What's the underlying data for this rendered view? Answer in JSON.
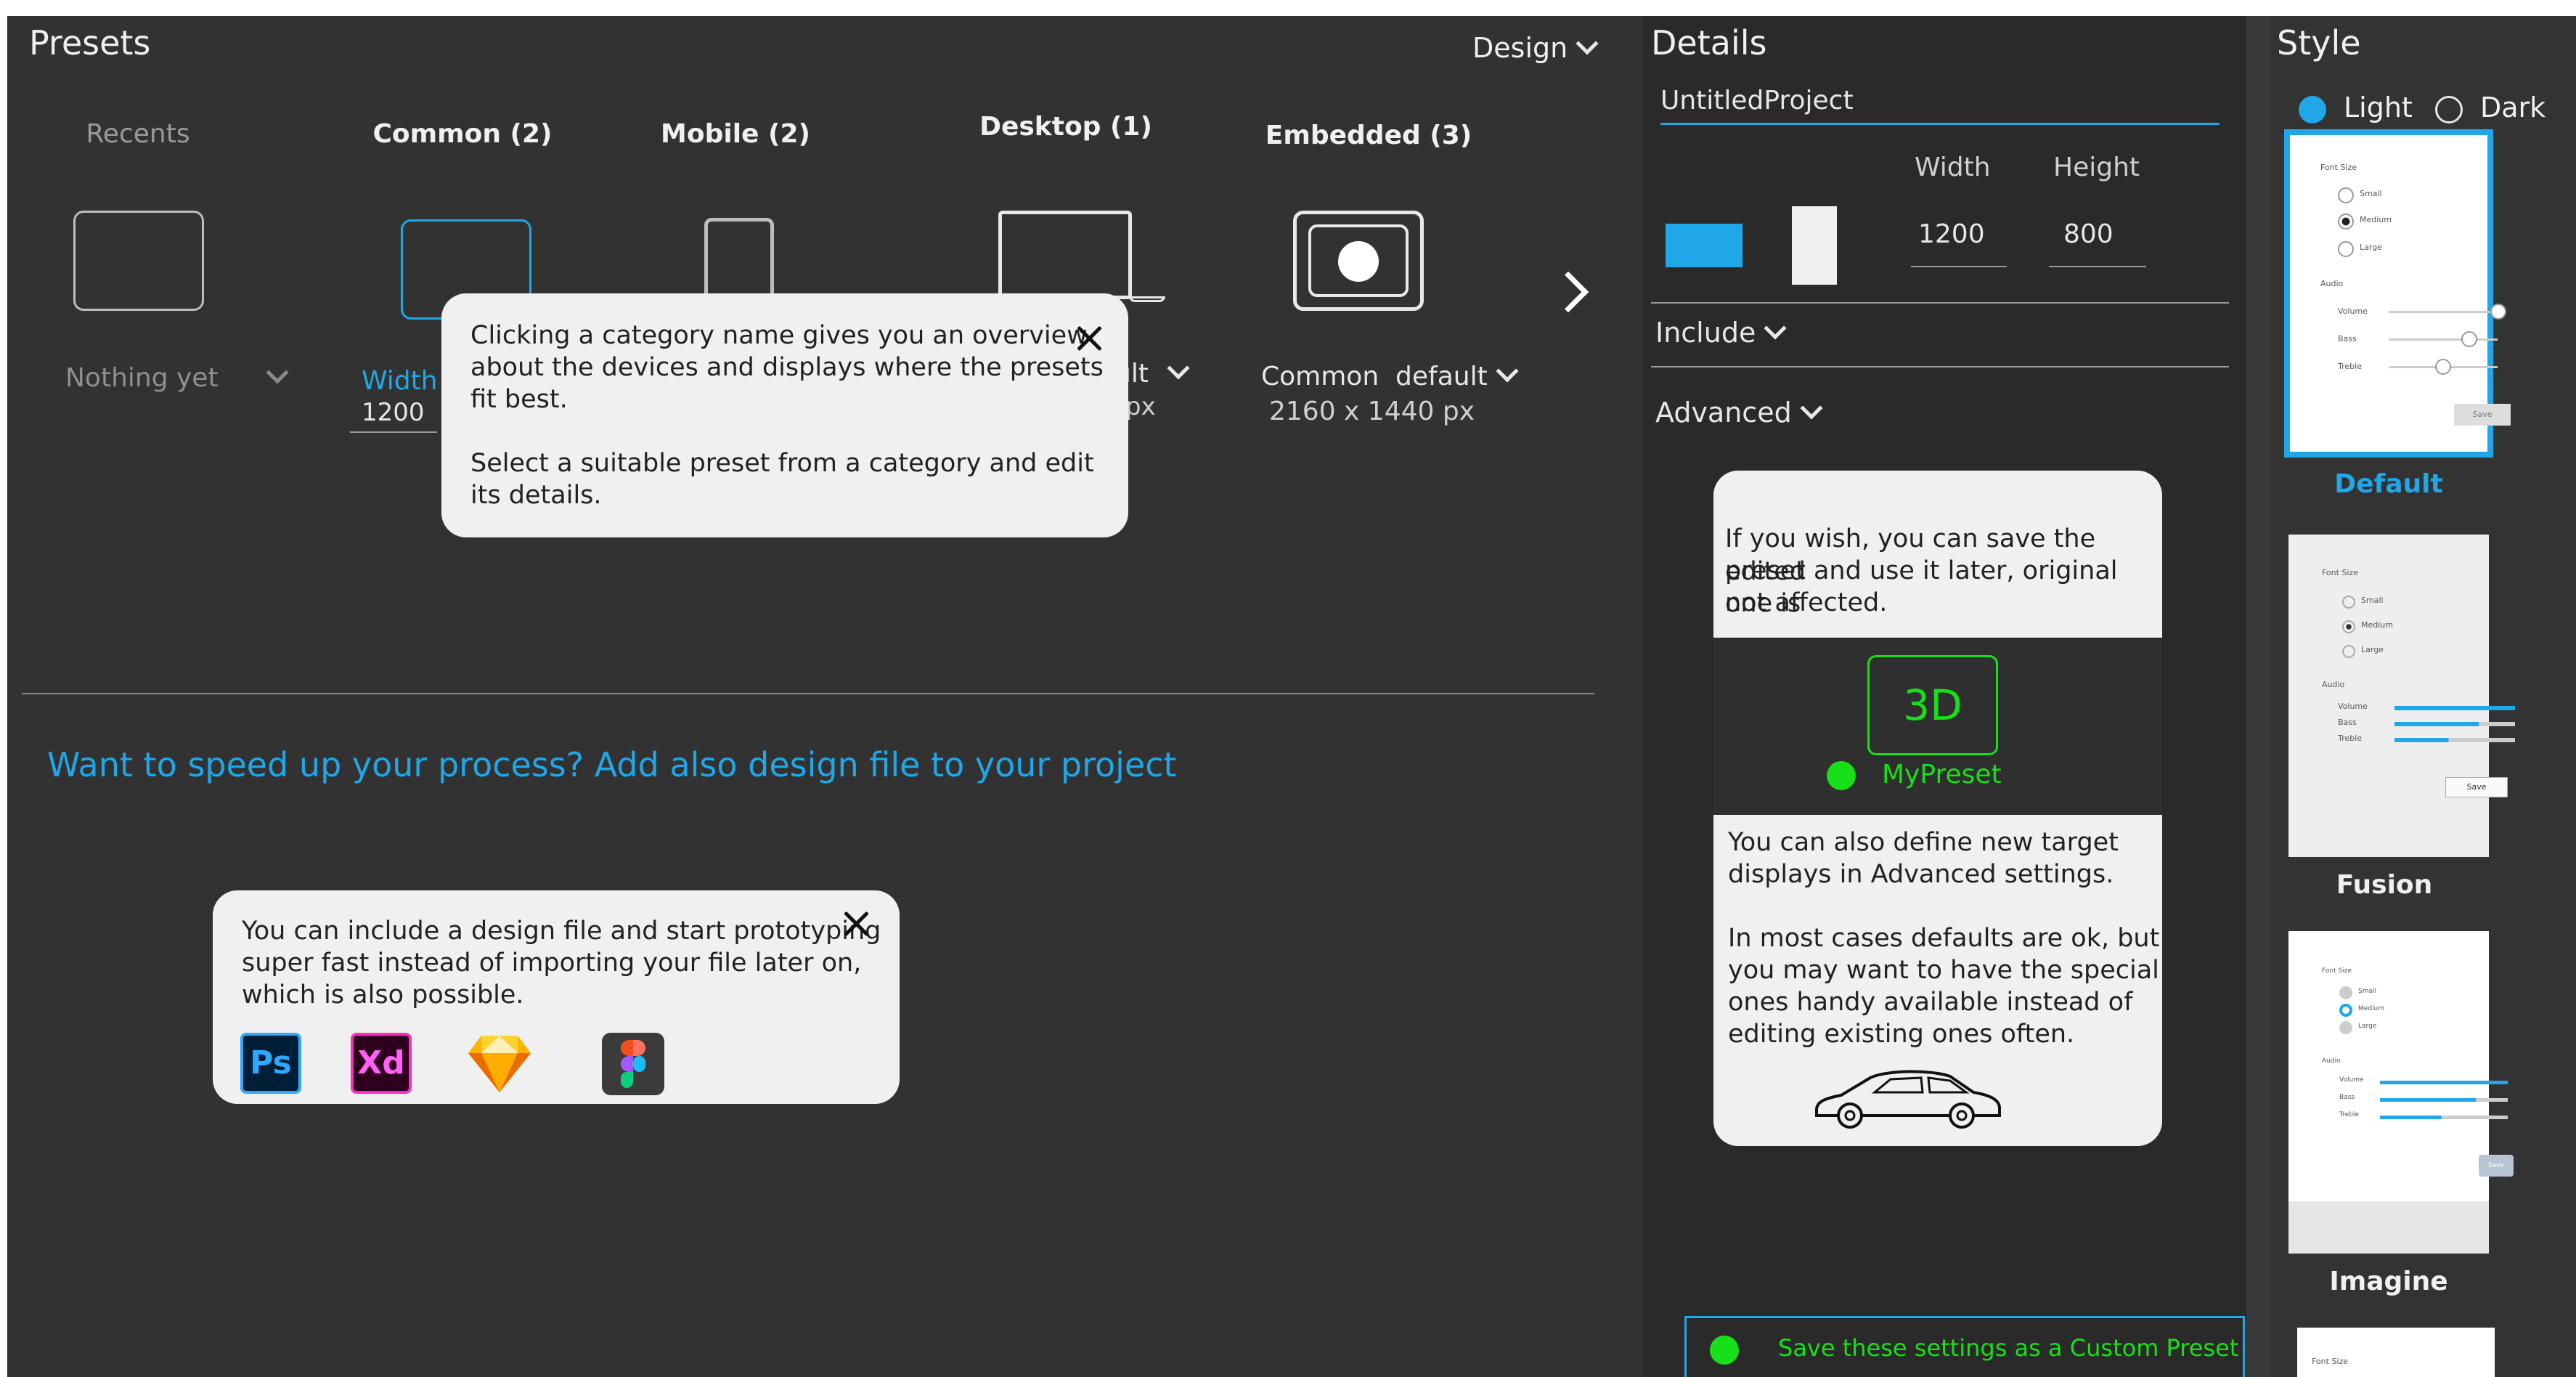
{
  "presets": {
    "title": "Presets",
    "mode_dropdown": "Design",
    "categories": [
      {
        "label": "Recents"
      },
      {
        "label": "Common (2)"
      },
      {
        "label": "Mobile (2)"
      },
      {
        "label": "Desktop (1)"
      },
      {
        "label": "Embedded (3)"
      }
    ],
    "recents_value": "Nothing yet",
    "common_field_label": "Width",
    "common_field_value": "1200",
    "desktop_partial_label": "ult",
    "desktop_partial_value": "px",
    "embedded_label": "Common  default",
    "embedded_size": "2160 x 1440 px",
    "promo_text": "Want to speed up your process?  Add also design file to your project",
    "popup1_line1": "Clicking a category name gives you an overview",
    "popup1_line2": "about the devices and displays where the presets",
    "popup1_line3": "fit best.",
    "popup1_line4": "Select a suitable preset from a  category and edit",
    "popup1_line5": "its details.",
    "popup2_line1": "You can include a design file and start prototyping",
    "popup2_line2": "super fast instead of importing your file later on,",
    "popup2_line3": "which is also possible.",
    "tool_icons": [
      {
        "name": "photoshop",
        "label": "Ps"
      },
      {
        "name": "xd",
        "label": "Xd"
      },
      {
        "name": "sketch",
        "label": ""
      },
      {
        "name": "figma",
        "label": ""
      }
    ]
  },
  "details": {
    "title": "Details",
    "project_name": "UntitledProject",
    "width_label": "Width",
    "height_label": "Height",
    "width_value": "1200",
    "height_value": "800",
    "include_label": "Include",
    "advanced_label": "Advanced",
    "card_top_1": "If you wish, you can save the edited",
    "card_top_2": "preset and use it later, original one is",
    "card_top_3": "not  affected.",
    "badge_3d": "3D",
    "mypreset": "MyPreset",
    "card_bottom_1": "You can also define new target",
    "card_bottom_2": "displays in Advanced settings.",
    "card_bottom_3": "In most cases defaults are ok, but",
    "card_bottom_4": "you may want to have the special",
    "card_bottom_5": "ones handy available instead of",
    "card_bottom_6": "editing  existing ones often.",
    "save_custom": "Save these settings as a Custom Preset",
    "accent_color": "#1fa7e8",
    "green_color": "#18e018"
  },
  "style": {
    "title": "Style",
    "light_label": "Light",
    "dark_label": "Dark",
    "selected": "Light",
    "themes": [
      {
        "label": "Default"
      },
      {
        "label": "Fusion"
      },
      {
        "label": "Imagine"
      }
    ],
    "mini": {
      "font_size": "Font Size",
      "small": "Small",
      "medium": "Medium",
      "large": "Large",
      "audio": "Audio",
      "volume": "Volume",
      "bass": "Bass",
      "treble": "Treble",
      "save": "Save"
    }
  }
}
